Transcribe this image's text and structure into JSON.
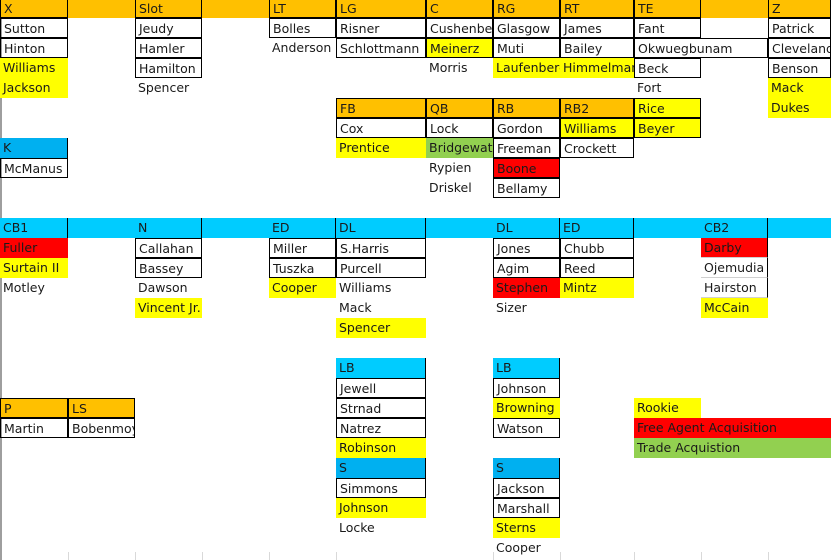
{
  "legend": {
    "rookie": "Rookie",
    "free_agent": "Free Agent Acquisition",
    "trade": "Trade Acquistion"
  },
  "colors": {
    "offense_header": "#ffc000",
    "defense_header": "#00ccff",
    "rookie": "#ffff00",
    "free_agent": "#ff0000",
    "trade": "#92d050"
  },
  "depth_chart": {
    "offense": {
      "X": [
        "Sutton",
        "Hinton",
        "Williams",
        "Jackson"
      ],
      "Slot": [
        "Jeudy",
        "Hamler",
        "Hamilton",
        "Spencer"
      ],
      "LT": [
        "Bolles",
        "Anderson"
      ],
      "LG": [
        "Risner",
        "Schlottmann"
      ],
      "C": [
        "Cushenberry",
        "Meinerz",
        "Morris"
      ],
      "RG": [
        "Glasgow",
        "Muti",
        "Laufenberg"
      ],
      "RT": [
        "James",
        "Bailey",
        "Himmelman"
      ],
      "TE": [
        "Fant",
        "Okwuegbunam",
        "Beck",
        "Fort",
        "Rice",
        "Beyer"
      ],
      "Z": [
        "Patrick",
        "Cleveland",
        "Benson",
        "Mack",
        "Dukes"
      ],
      "FB": [
        "Cox",
        "Prentice"
      ],
      "QB": [
        "Lock",
        "Bridgewater",
        "Rypien",
        "Driskel"
      ],
      "RB": [
        "Gordon",
        "Freeman",
        "Boone",
        "Bellamy"
      ],
      "RB2": [
        "Williams",
        "Crockett"
      ]
    },
    "special_teams": {
      "K": [
        "McManus"
      ],
      "P": [
        "Martin"
      ],
      "LS": [
        "Bobenmoyer"
      ]
    },
    "defense": {
      "CB1": [
        "Fuller",
        "Surtain II",
        "Motley"
      ],
      "N": [
        "Callahan",
        "Bassey",
        "Dawson",
        "Vincent Jr."
      ],
      "ED_left": [
        "Miller",
        "Tuszka",
        "Cooper"
      ],
      "DL_left": [
        "S.Harris",
        "Purcell",
        "Williams",
        "Mack",
        "Spencer"
      ],
      "DL_right": [
        "Jones",
        "Agim",
        "Stephen",
        "Sizer"
      ],
      "ED_right": [
        "Chubb",
        "Reed",
        "Mintz"
      ],
      "CB2": [
        "Darby",
        "Ojemudia",
        "Hairston",
        "McCain"
      ],
      "LB_left": [
        "Jewell",
        "Strnad",
        "Natrez",
        "Robinson"
      ],
      "LB_right": [
        "Johnson",
        "Browning",
        "Watson"
      ],
      "S_left": [
        "Simmons",
        "Johnson",
        "Locke"
      ],
      "S_right": [
        "Jackson",
        "Marshall",
        "Sterns",
        "Cooper"
      ]
    }
  },
  "cells": [
    {
      "c": 0,
      "r": 0,
      "t": "X",
      "f": "orange"
    },
    {
      "c": 2,
      "r": 0,
      "t": "Slot",
      "f": "orange"
    },
    {
      "c": 4,
      "r": 0,
      "t": "LT",
      "f": "orange"
    },
    {
      "c": 5,
      "r": 0,
      "t": "LG",
      "f": "orange"
    },
    {
      "c": 6,
      "r": 0,
      "t": "C",
      "f": "orange"
    },
    {
      "c": 7,
      "r": 0,
      "t": "RG",
      "f": "orange"
    },
    {
      "c": 8,
      "r": 0,
      "t": "RT",
      "f": "orange"
    },
    {
      "c": 9,
      "r": 0,
      "t": "TE",
      "f": "orange"
    },
    {
      "c": 11,
      "r": 0,
      "t": "Z",
      "f": "orange"
    },
    {
      "c": 0,
      "r": 1,
      "t": "Sutton"
    },
    {
      "c": 2,
      "r": 1,
      "t": "Jeudy"
    },
    {
      "c": 4,
      "r": 1,
      "t": "Bolles"
    },
    {
      "c": 5,
      "r": 1,
      "t": "Risner"
    },
    {
      "c": 6,
      "r": 1,
      "t": "Cushenberry"
    },
    {
      "c": 7,
      "r": 1,
      "t": "Glasgow"
    },
    {
      "c": 8,
      "r": 1,
      "t": "James"
    },
    {
      "c": 9,
      "r": 1,
      "t": "Fant"
    },
    {
      "c": 11,
      "r": 1,
      "t": "Patrick"
    },
    {
      "c": 0,
      "r": 2,
      "t": "Hinton"
    },
    {
      "c": 2,
      "r": 2,
      "t": "Hamler"
    },
    {
      "c": 4,
      "r": 2,
      "t": "Anderson"
    },
    {
      "c": 5,
      "r": 2,
      "t": "Schlottmann"
    },
    {
      "c": 6,
      "r": 2,
      "t": "Meinerz",
      "f": "rookie"
    },
    {
      "c": 7,
      "r": 2,
      "t": "Muti"
    },
    {
      "c": 8,
      "r": 2,
      "t": "Bailey"
    },
    {
      "c": 9,
      "r": 2,
      "t": "Okwuegbunam"
    },
    {
      "c": 11,
      "r": 2,
      "t": "Cleveland"
    },
    {
      "c": 0,
      "r": 3,
      "t": "Williams",
      "f": "rookie"
    },
    {
      "c": 2,
      "r": 3,
      "t": "Hamilton"
    },
    {
      "c": 6,
      "r": 3,
      "t": "Morris"
    },
    {
      "c": 7,
      "r": 3,
      "t": "Laufenberg",
      "f": "rookie"
    },
    {
      "c": 8,
      "r": 3,
      "t": "Himmelman",
      "f": "rookie"
    },
    {
      "c": 9,
      "r": 3,
      "t": "Beck"
    },
    {
      "c": 11,
      "r": 3,
      "t": "Benson"
    },
    {
      "c": 0,
      "r": 4,
      "t": "Jackson",
      "f": "rookie"
    },
    {
      "c": 2,
      "r": 4,
      "t": "Spencer"
    },
    {
      "c": 9,
      "r": 4,
      "t": "Fort"
    },
    {
      "c": 11,
      "r": 4,
      "t": "Mack",
      "f": "rookie"
    },
    {
      "c": 5,
      "r": 5,
      "t": "FB",
      "f": "orange"
    },
    {
      "c": 6,
      "r": 5,
      "t": "QB",
      "f": "orange"
    },
    {
      "c": 7,
      "r": 5,
      "t": "RB",
      "f": "orange"
    },
    {
      "c": 8,
      "r": 5,
      "t": "RB2",
      "f": "orange"
    },
    {
      "c": 9,
      "r": 5,
      "t": "Rice",
      "f": "rookie"
    },
    {
      "c": 11,
      "r": 5,
      "t": "Dukes",
      "f": "rookie"
    },
    {
      "c": 5,
      "r": 6,
      "t": "Cox"
    },
    {
      "c": 6,
      "r": 6,
      "t": "Lock"
    },
    {
      "c": 7,
      "r": 6,
      "t": "Gordon"
    },
    {
      "c": 8,
      "r": 6,
      "t": "Williams",
      "f": "rookie"
    },
    {
      "c": 9,
      "r": 6,
      "t": "Beyer",
      "f": "rookie"
    },
    {
      "c": 0,
      "r": 7,
      "t": "K",
      "f": "blue2"
    },
    {
      "c": 5,
      "r": 7,
      "t": "Prentice",
      "f": "rookie"
    },
    {
      "c": 6,
      "r": 7,
      "t": "Bridgewater",
      "f": "trade"
    },
    {
      "c": 7,
      "r": 7,
      "t": "Freeman"
    },
    {
      "c": 8,
      "r": 7,
      "t": "Crockett"
    },
    {
      "c": 0,
      "r": 8,
      "t": "McManus"
    },
    {
      "c": 6,
      "r": 8,
      "t": "Rypien"
    },
    {
      "c": 7,
      "r": 8,
      "t": "Boone",
      "f": "fa"
    },
    {
      "c": 6,
      "r": 9,
      "t": "Driskel"
    },
    {
      "c": 7,
      "r": 9,
      "t": "Bellamy"
    },
    {
      "c": 0,
      "r": 11,
      "t": "CB1",
      "f": "blue"
    },
    {
      "c": 2,
      "r": 11,
      "t": "N",
      "f": "blue"
    },
    {
      "c": 4,
      "r": 11,
      "t": "ED",
      "f": "blue"
    },
    {
      "c": 5,
      "r": 11,
      "t": "DL",
      "f": "blue"
    },
    {
      "c": 7,
      "r": 11,
      "t": "DL",
      "f": "blue"
    },
    {
      "c": 8,
      "r": 11,
      "t": "ED",
      "f": "blue"
    },
    {
      "c": 10,
      "r": 11,
      "t": "CB2",
      "f": "blue"
    },
    {
      "c": 0,
      "r": 12,
      "t": "Fuller",
      "f": "fa"
    },
    {
      "c": 2,
      "r": 12,
      "t": "Callahan"
    },
    {
      "c": 4,
      "r": 12,
      "t": "Miller"
    },
    {
      "c": 5,
      "r": 12,
      "t": "S.Harris"
    },
    {
      "c": 7,
      "r": 12,
      "t": "Jones"
    },
    {
      "c": 8,
      "r": 12,
      "t": "Chubb"
    },
    {
      "c": 10,
      "r": 12,
      "t": "Darby",
      "f": "fa"
    },
    {
      "c": 0,
      "r": 13,
      "t": "Surtain II",
      "f": "rookie"
    },
    {
      "c": 2,
      "r": 13,
      "t": "Bassey"
    },
    {
      "c": 4,
      "r": 13,
      "t": "Tuszka"
    },
    {
      "c": 5,
      "r": 13,
      "t": "Purcell"
    },
    {
      "c": 7,
      "r": 13,
      "t": "Agim"
    },
    {
      "c": 8,
      "r": 13,
      "t": "Reed"
    },
    {
      "c": 10,
      "r": 13,
      "t": "Ojemudia"
    },
    {
      "c": 0,
      "r": 14,
      "t": "Motley"
    },
    {
      "c": 2,
      "r": 14,
      "t": "Dawson"
    },
    {
      "c": 4,
      "r": 14,
      "t": "Cooper",
      "f": "rookie"
    },
    {
      "c": 5,
      "r": 14,
      "t": "Williams"
    },
    {
      "c": 7,
      "r": 14,
      "t": "Stephen",
      "f": "fa"
    },
    {
      "c": 8,
      "r": 14,
      "t": "Mintz",
      "f": "rookie"
    },
    {
      "c": 10,
      "r": 14,
      "t": "Hairston"
    },
    {
      "c": 2,
      "r": 15,
      "t": "Vincent Jr.",
      "f": "rookie"
    },
    {
      "c": 5,
      "r": 15,
      "t": "Mack"
    },
    {
      "c": 7,
      "r": 15,
      "t": "Sizer"
    },
    {
      "c": 10,
      "r": 15,
      "t": "McCain",
      "f": "rookie"
    },
    {
      "c": 5,
      "r": 16,
      "t": "Spencer",
      "f": "rookie"
    },
    {
      "c": 5,
      "r": 18,
      "t": "LB",
      "f": "blue"
    },
    {
      "c": 7,
      "r": 18,
      "t": "LB",
      "f": "blue"
    },
    {
      "c": 5,
      "r": 19,
      "t": "Jewell"
    },
    {
      "c": 7,
      "r": 19,
      "t": "Johnson"
    },
    {
      "c": 0,
      "r": 20,
      "t": "P",
      "f": "orange"
    },
    {
      "c": 1,
      "r": 20,
      "t": "LS",
      "f": "orange"
    },
    {
      "c": 5,
      "r": 20,
      "t": "Strnad"
    },
    {
      "c": 7,
      "r": 20,
      "t": "Browning",
      "f": "rookie"
    },
    {
      "c": 9,
      "r": 20,
      "t": "Rookie",
      "f": "rookie"
    },
    {
      "c": 0,
      "r": 21,
      "t": "Martin"
    },
    {
      "c": 1,
      "r": 21,
      "t": "Bobenmoyer"
    },
    {
      "c": 5,
      "r": 21,
      "t": "Natrez"
    },
    {
      "c": 7,
      "r": 21,
      "t": "Watson"
    },
    {
      "c": 9,
      "r": 21,
      "t": "Free Agent Acquisition",
      "f": "fa"
    },
    {
      "c": 5,
      "r": 22,
      "t": "Robinson",
      "f": "rookie"
    },
    {
      "c": 9,
      "r": 22,
      "t": "Trade Acquistion",
      "f": "trade"
    },
    {
      "c": 5,
      "r": 23,
      "t": "S",
      "f": "blue2"
    },
    {
      "c": 7,
      "r": 23,
      "t": "S",
      "f": "blue2"
    },
    {
      "c": 5,
      "r": 24,
      "t": "Simmons"
    },
    {
      "c": 7,
      "r": 24,
      "t": "Jackson"
    },
    {
      "c": 5,
      "r": 25,
      "t": "Johnson",
      "f": "rookie"
    },
    {
      "c": 7,
      "r": 25,
      "t": "Marshall"
    },
    {
      "c": 5,
      "r": 26,
      "t": "Locke"
    },
    {
      "c": 7,
      "r": 26,
      "t": "Sterns",
      "f": "rookie"
    },
    {
      "c": 7,
      "r": 27,
      "t": "Cooper"
    }
  ]
}
